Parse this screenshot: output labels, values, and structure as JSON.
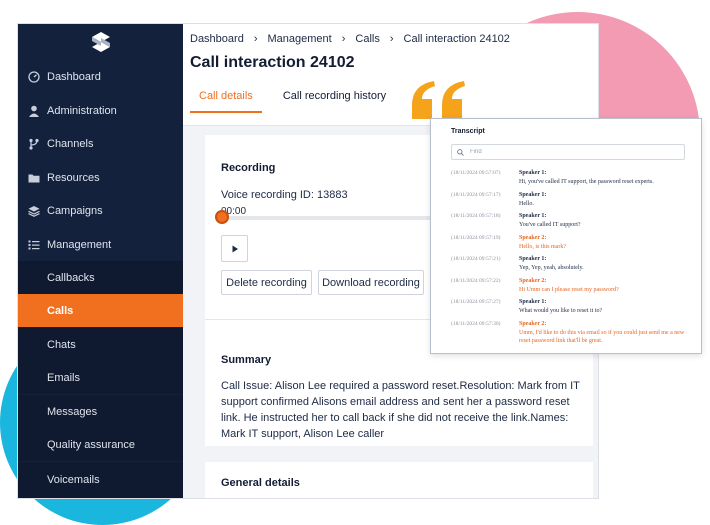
{
  "colors": {
    "accent": "#f07020",
    "sidebar": "#14213d",
    "pink": "#f49bb4",
    "cyan": "#1bb6dd"
  },
  "sidebar": {
    "logo": "logo-icon",
    "items": [
      {
        "label": "Dashboard",
        "icon": "dashboard-icon"
      },
      {
        "label": "Administration",
        "icon": "user-icon"
      },
      {
        "label": "Channels",
        "icon": "channels-icon"
      },
      {
        "label": "Resources",
        "icon": "folder-icon"
      },
      {
        "label": "Campaigns",
        "icon": "layers-icon"
      },
      {
        "label": "Management",
        "icon": "list-icon"
      }
    ],
    "subitems": [
      {
        "label": "Callbacks"
      },
      {
        "label": "Calls",
        "active": true
      },
      {
        "label": "Chats"
      },
      {
        "label": "Emails"
      },
      {
        "label": "Messages"
      },
      {
        "label": "Quality assurance"
      },
      {
        "label": "Voicemails"
      }
    ]
  },
  "header": {
    "breadcrumbs": [
      "Dashboard",
      "Management",
      "Calls",
      "Call interaction 24102"
    ],
    "title": "Call interaction 24102",
    "tabs": [
      {
        "label": "Call details",
        "active": true
      },
      {
        "label": "Call recording history",
        "active": false
      }
    ]
  },
  "recording": {
    "heading": "Recording",
    "voice_id": "Voice recording ID: 13883",
    "time": "00:00",
    "progress": 0,
    "delete_label": "Delete recording",
    "download_label": "Download recording"
  },
  "summary": {
    "heading": "Summary",
    "text": "Call Issue: Alison Lee required a password reset.Resolution: Mark from IT support confirmed Alisons email address and sent her a password reset link. He instructed her to call back if she did not receive the link.Names: Mark IT support, Alison Lee caller"
  },
  "general": {
    "heading": "General details"
  },
  "transcript": {
    "title": "Transcript",
    "search_placeholder": "Find",
    "messages": [
      {
        "time": "(18/11/2024 09:57:07)",
        "speaker": "Speaker 1:",
        "text": "Hi, you've called IT support, the password reset experts.",
        "color": "blue"
      },
      {
        "time": "(18/11/2024 09:57:17)",
        "speaker": "Speaker 1:",
        "text": "Hello.",
        "color": "blue"
      },
      {
        "time": "(18/11/2024 09:57:18)",
        "speaker": "Speaker 1:",
        "text": "You've called IT support?",
        "color": "blue"
      },
      {
        "time": "(18/11/2024 09:57:19)",
        "speaker": "Speaker 2:",
        "text": "Hello, is this mark?",
        "color": "orange"
      },
      {
        "time": "(18/11/2024 09:57:21)",
        "speaker": "Speaker 1:",
        "text": "Yep, Yep, yeah, absolutely.",
        "color": "blue"
      },
      {
        "time": "(18/11/2024 09:57:22)",
        "speaker": "Speaker 2:",
        "text": "Hi Umm can I please reset my password?",
        "color": "orange"
      },
      {
        "time": "(18/11/2024 09:57:27)",
        "speaker": "Speaker 1:",
        "text": "What would you like to reset it to?",
        "color": "blue"
      },
      {
        "time": "(18/11/2024 09:57:30)",
        "speaker": "Speaker 2:",
        "text": "Umm, I'd like to do this via email so if you could just send me a new reset password link that'll be great.",
        "color": "orange"
      }
    ]
  }
}
